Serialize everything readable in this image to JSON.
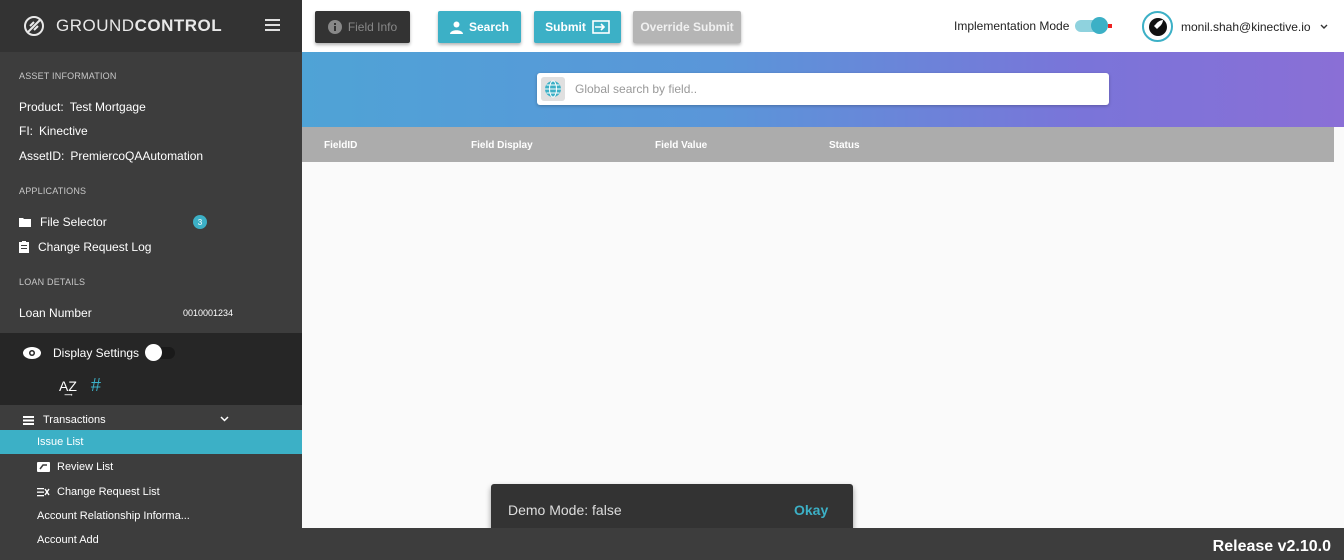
{
  "brand": {
    "name_light": "GROUND",
    "name_bold": "CONTROL"
  },
  "asset_info": {
    "title": "ASSET INFORMATION",
    "product_label": "Product:",
    "product_value": "Test Mortgage",
    "fi_label": "FI:",
    "fi_value": "Kinective",
    "asset_label": "AssetID:",
    "asset_value": "PremiercoQAAutomation"
  },
  "applications": {
    "title": "APPLICATIONS",
    "file_selector": "File Selector",
    "file_selector_badge": "3",
    "change_request_log": "Change Request Log"
  },
  "loan_details": {
    "title": "LOAN DETAILS",
    "loan_number_label": "Loan Number",
    "loan_number_value": "0010001234"
  },
  "display_settings": {
    "label": "Display Settings",
    "sort_az": "A͢Z",
    "hash": "#"
  },
  "transactions": {
    "label": "Transactions",
    "items": [
      "Issue List",
      "Review List",
      "Change Request List",
      "Account Relationship Informa...",
      "Account Add"
    ],
    "active_index": 0
  },
  "toolbar": {
    "field_info": "Field Info",
    "search": "Search",
    "submit": "Submit",
    "override_submit": "Override Submit",
    "implementation_mode": "Implementation Mode",
    "user_email": "monil.shah@kinective.io"
  },
  "global_search": {
    "placeholder": "Global search by field.."
  },
  "table": {
    "columns": [
      "FieldID",
      "Field Display",
      "Field Value",
      "Status"
    ]
  },
  "snackbar": {
    "message": "Demo Mode: false",
    "action": "Okay"
  },
  "footer": {
    "release": "Release v2.10.0"
  },
  "colors": {
    "accent": "#3cb0c6",
    "sidebar": "#3d3d3d",
    "sidebar_dark": "#262626",
    "table_header": "#acacac"
  }
}
